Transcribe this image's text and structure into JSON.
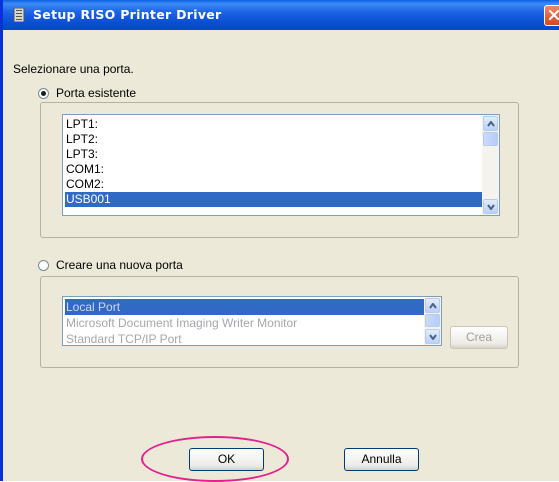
{
  "window": {
    "title": "Setup RISO Printer Driver"
  },
  "prompt": "Selezionare una porta.",
  "existing_port": {
    "label": "Porta esistente",
    "selected": true,
    "items": [
      "LPT1:",
      "LPT2:",
      "LPT3:",
      "COM1:",
      "COM2:",
      "USB001"
    ],
    "selected_item": "USB001"
  },
  "new_port": {
    "label": "Creare una nuova porta",
    "selected": false,
    "items": [
      "Local Port",
      "Microsoft Document Imaging Writer Monitor",
      "Standard TCP/IP Port"
    ],
    "selected_item": "Local Port",
    "create_label": "Crea"
  },
  "buttons": {
    "ok": "OK",
    "cancel": "Annulla"
  },
  "colors": {
    "titlebar": "#0a4fd2",
    "selection": "#316ac5",
    "highlight_ring": "#e3218e",
    "dialog_bg": "#ece9d8"
  }
}
